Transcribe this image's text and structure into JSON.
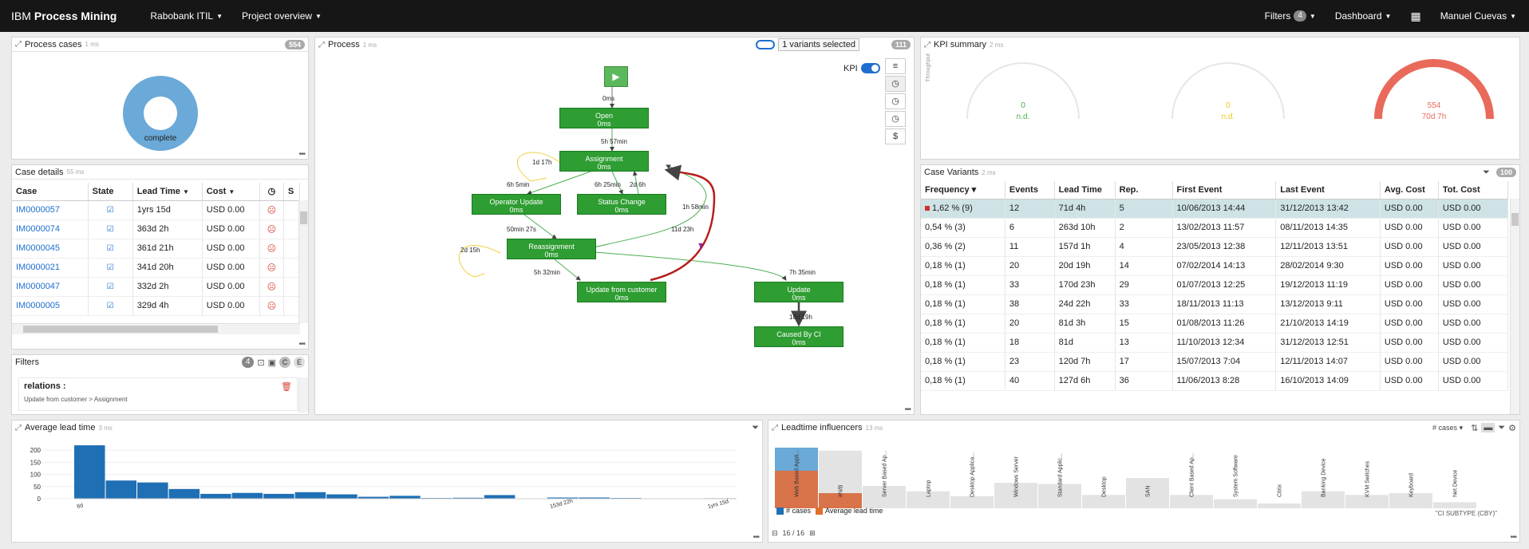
{
  "topbar": {
    "brand_a": "IBM",
    "brand_b": "Process Mining",
    "nav": [
      "Rabobank ITIL",
      "Project overview"
    ],
    "filters_label": "Filters",
    "filters_count": "4",
    "dashboard_label": "Dashboard",
    "user": "Manuel Cuevas"
  },
  "process_cases": {
    "title": "Process cases",
    "sub": "1 ms",
    "count": "554",
    "donut_label": "complete",
    "color": "#6aa9d8"
  },
  "case_details": {
    "title": "Case details",
    "sub": "55 ms",
    "columns": [
      "Case",
      "State",
      "Lead Time",
      "Cost"
    ],
    "rows": [
      {
        "case": "IM0000057",
        "lead": "1yrs 15d",
        "cost": "USD 0.00"
      },
      {
        "case": "IM0000074",
        "lead": "363d 2h",
        "cost": "USD 0.00"
      },
      {
        "case": "IM0000045",
        "lead": "361d 21h",
        "cost": "USD 0.00"
      },
      {
        "case": "IM0000021",
        "lead": "341d 20h",
        "cost": "USD 0.00"
      },
      {
        "case": "IM0000047",
        "lead": "332d 2h",
        "cost": "USD 0.00"
      },
      {
        "case": "IM0000005",
        "lead": "329d 4h",
        "cost": "USD 0.00"
      }
    ]
  },
  "filters_panel": {
    "title": "Filters",
    "count": "4",
    "relation_title": "relations :",
    "relation_text": "Update from customer > Assignment"
  },
  "process": {
    "title": "Process",
    "sub": "1 ms",
    "variants": "1 variants selected",
    "count": "111",
    "kpi_label": "KPI",
    "nodes": [
      {
        "name": "Open",
        "time": "0ms"
      },
      {
        "name": "Assignment",
        "time": "0ms"
      },
      {
        "name": "Operator Update",
        "time": "0ms"
      },
      {
        "name": "Status Change",
        "time": "0ms"
      },
      {
        "name": "Reassignment",
        "time": "0ms"
      },
      {
        "name": "Update from customer",
        "time": "0ms"
      },
      {
        "name": "Update",
        "time": "0ms"
      },
      {
        "name": "Caused By CI",
        "time": "0ms"
      }
    ],
    "edges": [
      "0ms",
      "5h 57min",
      "1d 17h",
      "6h 5min",
      "6h 25min",
      "2d 6h",
      "1h 58min",
      "11d 23h",
      "50min 27s",
      "2d 15h",
      "5h 32min",
      "7h 35min",
      "10d 19h"
    ],
    "tools": [
      "≡",
      "◷",
      "◷",
      "◷",
      "$"
    ]
  },
  "kpi_summary": {
    "title": "KPI summary",
    "sub": "2 ms",
    "axis_label": "Throughput",
    "gauges": [
      {
        "value": "0",
        "sub": "n.d.",
        "fill": 0,
        "color": "#4caf50"
      },
      {
        "value": "0",
        "sub": "n.d.",
        "fill": 0,
        "color": "#f0c419"
      },
      {
        "value": "554",
        "sub": "70d 7h",
        "fill": 1,
        "color": "#e96a5a"
      }
    ]
  },
  "case_variants": {
    "title": "Case Variants",
    "sub": "2 ms",
    "count": "100",
    "columns": [
      "Frequency",
      "Events",
      "Lead Time",
      "Rep.",
      "First Event",
      "Last Event",
      "Avg. Cost",
      "Tot. Cost"
    ],
    "rows": [
      [
        "1,62 % (9)",
        "12",
        "71d 4h",
        "5",
        "10/06/2013 14:44",
        "31/12/2013 13:42",
        "USD 0.00",
        "USD 0.00"
      ],
      [
        "0,54 % (3)",
        "6",
        "263d 10h",
        "2",
        "13/02/2013 11:57",
        "08/11/2013 14:35",
        "USD 0.00",
        "USD 0.00"
      ],
      [
        "0,36 % (2)",
        "11",
        "157d 1h",
        "4",
        "23/05/2013 12:38",
        "12/11/2013 13:51",
        "USD 0.00",
        "USD 0.00"
      ],
      [
        "0,18 % (1)",
        "20",
        "20d 19h",
        "14",
        "07/02/2014 14:13",
        "28/02/2014 9:30",
        "USD 0.00",
        "USD 0.00"
      ],
      [
        "0,18 % (1)",
        "33",
        "170d 23h",
        "29",
        "01/07/2013 12:25",
        "19/12/2013 11:19",
        "USD 0.00",
        "USD 0.00"
      ],
      [
        "0,18 % (1)",
        "38",
        "24d 22h",
        "33",
        "18/11/2013 11:13",
        "13/12/2013 9:11",
        "USD 0.00",
        "USD 0.00"
      ],
      [
        "0,18 % (1)",
        "20",
        "81d 3h",
        "15",
        "01/08/2013 11:26",
        "21/10/2013 14:19",
        "USD 0.00",
        "USD 0.00"
      ],
      [
        "0,18 % (1)",
        "18",
        "81d",
        "13",
        "11/10/2013 12:34",
        "31/12/2013 12:51",
        "USD 0.00",
        "USD 0.00"
      ],
      [
        "0,18 % (1)",
        "23",
        "120d 7h",
        "17",
        "15/07/2013 7:04",
        "12/11/2013 14:07",
        "USD 0.00",
        "USD 0.00"
      ],
      [
        "0,18 % (1)",
        "40",
        "127d 6h",
        "36",
        "11/06/2013 8:28",
        "16/10/2013 14:09",
        "USD 0.00",
        "USD 0.00"
      ]
    ]
  },
  "lead_time": {
    "title": "Average lead time",
    "sub": "3 ms",
    "yticks": [
      "200",
      "150",
      "100",
      "50",
      "0"
    ],
    "xticks": [
      "6d",
      "153d 22h",
      "1yrs 15d"
    ]
  },
  "chart_data": {
    "type": "bar",
    "title": "Average lead time",
    "ylim": [
      0,
      230
    ],
    "categories": [
      "6d",
      "",
      "",
      "",
      "",
      "",
      "",
      "",
      "",
      "",
      "",
      "",
      "",
      "",
      "",
      "153d 22h",
      "",
      "",
      "",
      "",
      "1yrs 15d"
    ],
    "values": [
      220,
      75,
      67,
      40,
      20,
      24,
      20,
      27,
      18,
      8,
      12,
      3,
      4,
      15,
      0,
      5,
      5,
      3,
      0,
      0,
      2
    ],
    "xticks_shown": [
      "6d",
      "153d 22h",
      "1yrs 15d"
    ]
  },
  "influencers": {
    "title": "Leadtime influencers",
    "sub": "13 ms",
    "dropdown": "# cases",
    "legend_cases": "# cases",
    "legend_avg": "Average lead time",
    "axis_caption": "\"CI SUBTYPE (CBY)\"",
    "pager": "16 / 16",
    "bars": [
      {
        "label": "Web Based Appli...",
        "cases": 1.0,
        "avg": 0.62
      },
      {
        "label": "#N/B",
        "cases": 0.95,
        "avg": 0.25
      },
      {
        "label": "Server Based Ap...",
        "cases": 0.37,
        "avg": 0
      },
      {
        "label": "Laptop",
        "cases": 0.28,
        "avg": 0
      },
      {
        "label": "Desktop Applica...",
        "cases": 0.2,
        "avg": 0
      },
      {
        "label": "Windows Server",
        "cases": 0.42,
        "avg": 0
      },
      {
        "label": "Standard Applic...",
        "cases": 0.4,
        "avg": 0
      },
      {
        "label": "Desktop",
        "cases": 0.22,
        "avg": 0
      },
      {
        "label": "SAN",
        "cases": 0.5,
        "avg": 0
      },
      {
        "label": "Client Based Ap...",
        "cases": 0.22,
        "avg": 0
      },
      {
        "label": "System Software",
        "cases": 0.15,
        "avg": 0
      },
      {
        "label": "Citrix",
        "cases": 0.08,
        "avg": 0
      },
      {
        "label": "Banking Device",
        "cases": 0.28,
        "avg": 0
      },
      {
        "label": "KVM Switches",
        "cases": 0.22,
        "avg": 0
      },
      {
        "label": "Keyboard",
        "cases": 0.25,
        "avg": 0
      },
      {
        "label": "Net Device",
        "cases": 0.1,
        "avg": 0
      }
    ],
    "cases_color": "#6aa9d8",
    "avg_color": "#d9734a"
  }
}
